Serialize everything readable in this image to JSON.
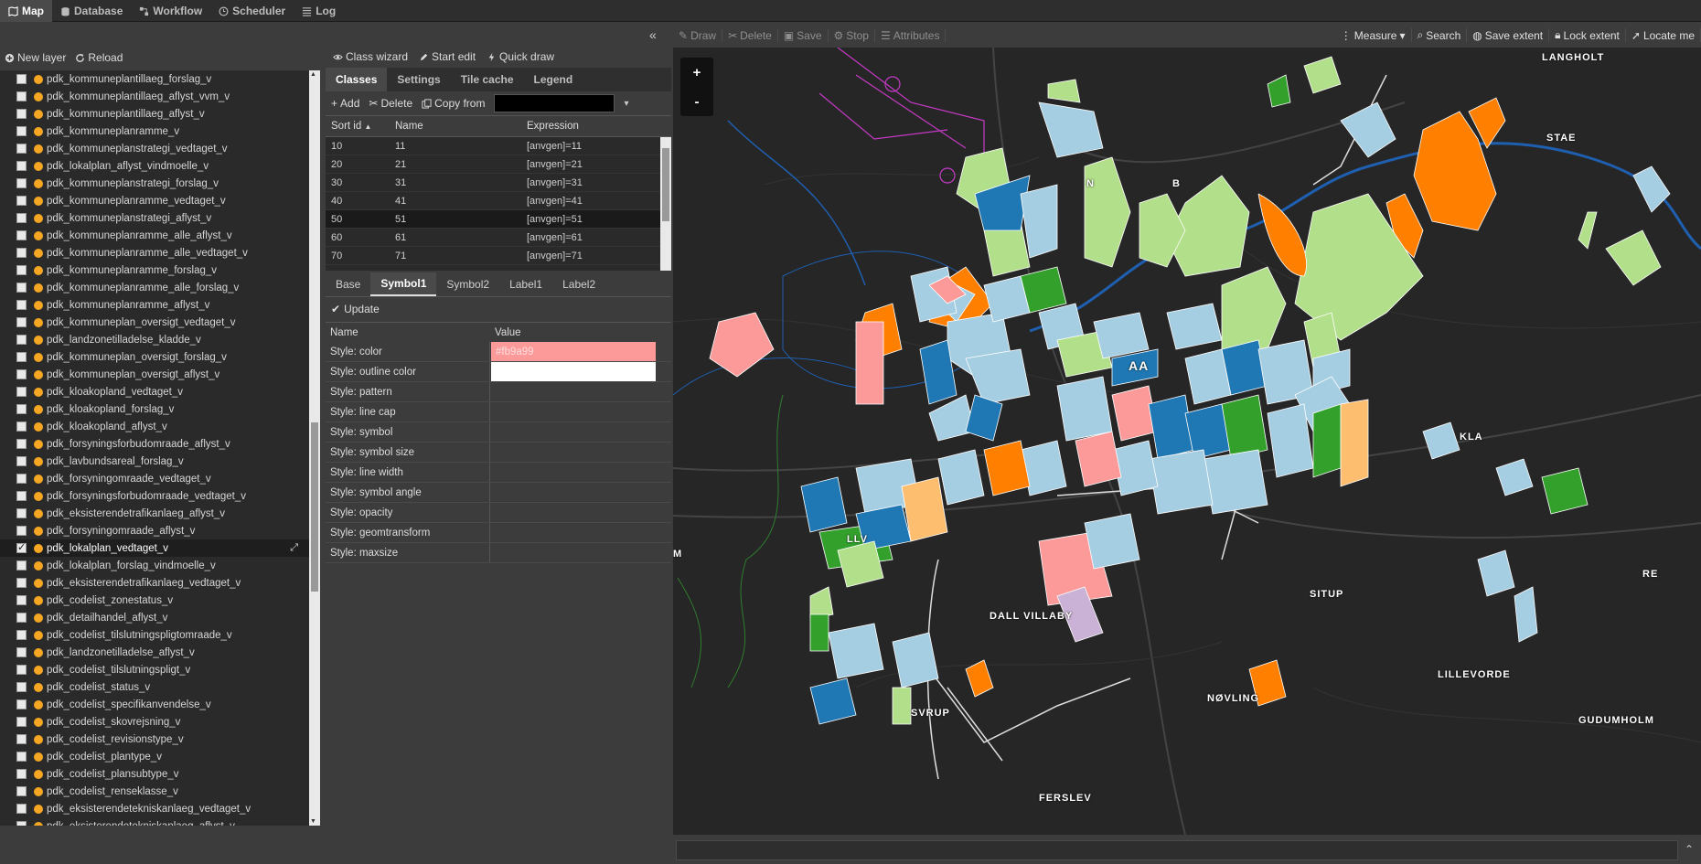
{
  "nav": {
    "tabs": [
      {
        "label": "Map",
        "icon": "map-icon"
      },
      {
        "label": "Database",
        "icon": "database-icon"
      },
      {
        "label": "Workflow",
        "icon": "workflow-icon"
      },
      {
        "label": "Scheduler",
        "icon": "clock-icon"
      },
      {
        "label": "Log",
        "icon": "list-icon"
      }
    ]
  },
  "layer_panel": {
    "new_layer": "New layer",
    "reload": "Reload",
    "layers": [
      {
        "name": "pdk_kommuneplantillaeg_forslag_v",
        "checked": false
      },
      {
        "name": "pdk_kommuneplantillaeg_aflyst_vvm_v",
        "checked": false
      },
      {
        "name": "pdk_kommuneplantillaeg_aflyst_v",
        "checked": false
      },
      {
        "name": "pdk_kommuneplanramme_v",
        "checked": false
      },
      {
        "name": "pdk_kommuneplanstrategi_vedtaget_v",
        "checked": false
      },
      {
        "name": "pdk_lokalplan_aflyst_vindmoelle_v",
        "checked": false
      },
      {
        "name": "pdk_kommuneplanstrategi_forslag_v",
        "checked": false
      },
      {
        "name": "pdk_kommuneplanramme_vedtaget_v",
        "checked": false
      },
      {
        "name": "pdk_kommuneplanstrategi_aflyst_v",
        "checked": false
      },
      {
        "name": "pdk_kommuneplanramme_alle_aflyst_v",
        "checked": false
      },
      {
        "name": "pdk_kommuneplanramme_alle_vedtaget_v",
        "checked": false
      },
      {
        "name": "pdk_kommuneplanramme_forslag_v",
        "checked": false
      },
      {
        "name": "pdk_kommuneplanramme_alle_forslag_v",
        "checked": false
      },
      {
        "name": "pdk_kommuneplanramme_aflyst_v",
        "checked": false
      },
      {
        "name": "pdk_kommuneplan_oversigt_vedtaget_v",
        "checked": false
      },
      {
        "name": "pdk_landzonetilladelse_kladde_v",
        "checked": false
      },
      {
        "name": "pdk_kommuneplan_oversigt_forslag_v",
        "checked": false
      },
      {
        "name": "pdk_kommuneplan_oversigt_aflyst_v",
        "checked": false
      },
      {
        "name": "pdk_kloakopland_vedtaget_v",
        "checked": false
      },
      {
        "name": "pdk_kloakopland_forslag_v",
        "checked": false
      },
      {
        "name": "pdk_kloakopland_aflyst_v",
        "checked": false
      },
      {
        "name": "pdk_forsyningsforbudomraade_aflyst_v",
        "checked": false
      },
      {
        "name": "pdk_lavbundsareal_forslag_v",
        "checked": false
      },
      {
        "name": "pdk_forsyningomraade_vedtaget_v",
        "checked": false
      },
      {
        "name": "pdk_forsyningsforbudomraade_vedtaget_v",
        "checked": false
      },
      {
        "name": "pdk_eksisterendetrafikanlaeg_aflyst_v",
        "checked": false
      },
      {
        "name": "pdk_forsyningomraade_aflyst_v",
        "checked": false
      },
      {
        "name": "pdk_lokalplan_vedtaget_v",
        "checked": true,
        "selected": true
      },
      {
        "name": "pdk_lokalplan_forslag_vindmoelle_v",
        "checked": false
      },
      {
        "name": "pdk_eksisterendetrafikanlaeg_vedtaget_v",
        "checked": false
      },
      {
        "name": "pdk_codelist_zonestatus_v",
        "checked": false
      },
      {
        "name": "pdk_detailhandel_aflyst_v",
        "checked": false
      },
      {
        "name": "pdk_codelist_tilslutningspligtomraade_v",
        "checked": false
      },
      {
        "name": "pdk_landzonetilladelse_aflyst_v",
        "checked": false
      },
      {
        "name": "pdk_codelist_tilslutningspligt_v",
        "checked": false
      },
      {
        "name": "pdk_codelist_status_v",
        "checked": false
      },
      {
        "name": "pdk_codelist_specifikanvendelse_v",
        "checked": false
      },
      {
        "name": "pdk_codelist_skovrejsning_v",
        "checked": false
      },
      {
        "name": "pdk_codelist_revisionstype_v",
        "checked": false
      },
      {
        "name": "pdk_codelist_plantype_v",
        "checked": false
      },
      {
        "name": "pdk_codelist_plansubtype_v",
        "checked": false
      },
      {
        "name": "pdk_codelist_renseklasse_v",
        "checked": false
      },
      {
        "name": "pdk_eksisterendetekniskanlaeg_vedtaget_v",
        "checked": false
      },
      {
        "name": "pdk_eksisterendetekniskanlaeg_aflyst_v",
        "checked": false
      }
    ]
  },
  "style_panel": {
    "toolbar": {
      "class_wizard": "Class wizard",
      "start_edit": "Start edit",
      "quick_draw": "Quick draw"
    },
    "tabs": [
      "Classes",
      "Settings",
      "Tile cache",
      "Legend"
    ],
    "class_toolbar": {
      "add": "Add",
      "delete": "Delete",
      "copy_from": "Copy from"
    },
    "grid": {
      "headers": [
        "Sort id",
        "Name",
        "Expression"
      ],
      "rows": [
        {
          "sort": "10",
          "name": "11",
          "expr": "[anvgen]=11"
        },
        {
          "sort": "20",
          "name": "21",
          "expr": "[anvgen]=21"
        },
        {
          "sort": "30",
          "name": "31",
          "expr": "[anvgen]=31"
        },
        {
          "sort": "40",
          "name": "41",
          "expr": "[anvgen]=41"
        },
        {
          "sort": "50",
          "name": "51",
          "expr": "[anvgen]=51",
          "selected": true
        },
        {
          "sort": "60",
          "name": "61",
          "expr": "[anvgen]=61"
        },
        {
          "sort": "70",
          "name": "71",
          "expr": "[anvgen]=71"
        }
      ]
    },
    "sub_tabs": [
      "Base",
      "Symbol1",
      "Symbol2",
      "Label1",
      "Label2"
    ],
    "update": "Update",
    "props_headers": [
      "Name",
      "Value"
    ],
    "props": [
      {
        "name": "Style: color",
        "value": "#fb9a99",
        "kind": "pink"
      },
      {
        "name": "Style: outline color",
        "value": "",
        "kind": "white"
      },
      {
        "name": "Style: pattern",
        "value": ""
      },
      {
        "name": "Style: line cap",
        "value": ""
      },
      {
        "name": "Style: symbol",
        "value": ""
      },
      {
        "name": "Style: symbol size",
        "value": ""
      },
      {
        "name": "Style: line width",
        "value": ""
      },
      {
        "name": "Style: symbol angle",
        "value": ""
      },
      {
        "name": "Style: opacity",
        "value": ""
      },
      {
        "name": "Style: geomtransform",
        "value": ""
      },
      {
        "name": "Style: maxsize",
        "value": ""
      }
    ]
  },
  "map_toolbar": {
    "left": [
      "Draw",
      "Delete",
      "Save",
      "Stop",
      "Attributes"
    ],
    "right": [
      "Measure",
      "Search",
      "Save extent",
      "Lock extent",
      "Locate me"
    ]
  },
  "map": {
    "zoom_in": "+",
    "zoom_out": "-",
    "places": [
      {
        "label": "LANGHOLT"
      },
      {
        "label": "STAE"
      },
      {
        "label": "N"
      },
      {
        "label": "B"
      },
      {
        "label": "AA"
      },
      {
        "label": "KLA"
      },
      {
        "label": "DALL VILLABY"
      },
      {
        "label": "SITUP"
      },
      {
        "label": "LILLEVORDE"
      },
      {
        "label": "NØVLING"
      },
      {
        "label": "SVRUP"
      },
      {
        "label": "GUDUMHOLM"
      },
      {
        "label": "FERSLEV"
      },
      {
        "label": "M"
      },
      {
        "label": "LLV"
      },
      {
        "label": "RE"
      }
    ]
  },
  "colors": {
    "lightgreen": "#b2df8a",
    "green": "#33a02c",
    "lightblue": "#a6cee3",
    "blue": "#1f78b4",
    "orange": "#ff7f00",
    "lightorange": "#fdbf6f",
    "pink": "#fb9a99",
    "purple": "#cab2d6"
  }
}
